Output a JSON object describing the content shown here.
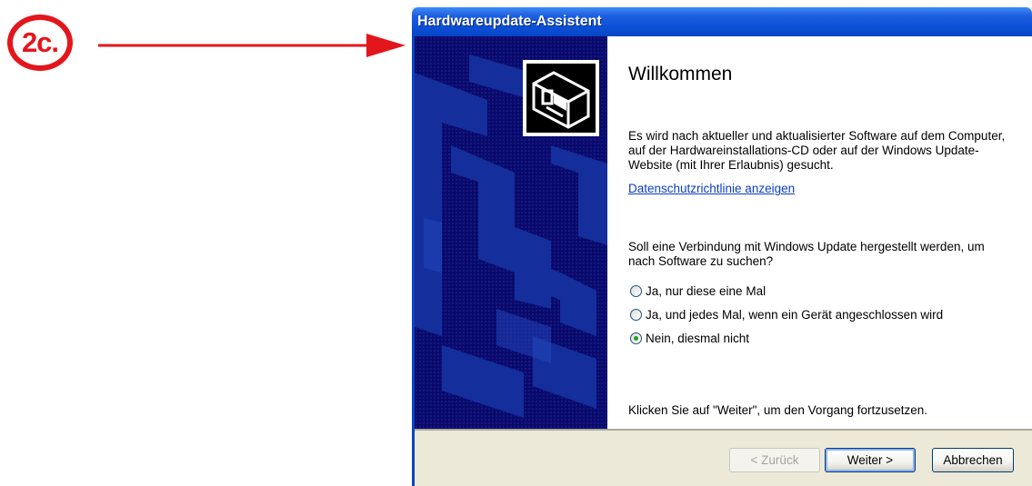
{
  "annotation": {
    "step_label": "2c."
  },
  "window": {
    "title": "Hardwareupdate-Assistent"
  },
  "content": {
    "heading": "Willkommen",
    "description": "Es wird nach aktueller und aktualisierter Software auf dem Computer, auf der Hardwareinstallations-CD oder auf der Windows Update-Website (mit Ihrer Erlaubnis) gesucht.",
    "privacy_link": "Datenschutzrichtlinie anzeigen",
    "question": "Soll eine Verbindung mit Windows Update hergestellt werden, um nach Software zu suchen?",
    "options": [
      {
        "label": "Ja, nur diese eine Mal",
        "selected": false
      },
      {
        "label": "Ja, und jedes Mal, wenn ein Gerät angeschlossen wird",
        "selected": false
      },
      {
        "label": "Nein, diesmal nicht",
        "selected": true
      }
    ],
    "footer": "Klicken Sie auf \"Weiter\", um den Vorgang fortzusetzen."
  },
  "buttons": {
    "back": "< Zurück",
    "next": "Weiter >",
    "cancel": "Abbrechen"
  },
  "colors": {
    "annotation_red": "#e3161c",
    "titlebar_blue": "#0a4fd6",
    "sidebar_navy": "#0a0a6c",
    "selected_radio_green": "#21a121"
  }
}
